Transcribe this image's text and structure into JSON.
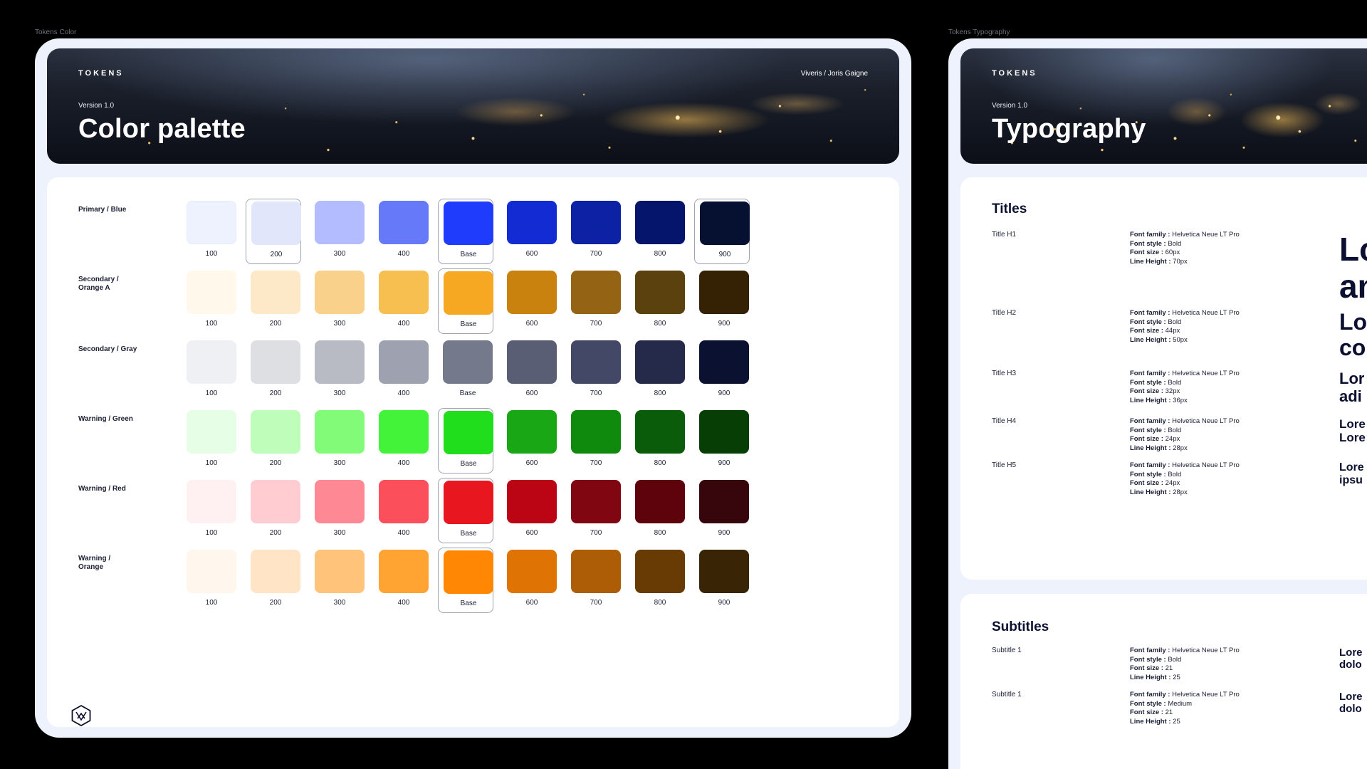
{
  "color_frame": {
    "label": "Tokens Color",
    "hero": {
      "tag": "TOKENS",
      "author": "Viveris / Joris Gaigne",
      "version": "Version 1.0",
      "title": "Color palette"
    },
    "palettes": [
      {
        "name": "Primary / Blue",
        "swatches": [
          {
            "label": "100",
            "color": "#eef2ff"
          },
          {
            "label": "200",
            "color": "#e1e6fb"
          },
          {
            "label": "300",
            "color": "#b2bcfe"
          },
          {
            "label": "400",
            "color": "#6679f9"
          },
          {
            "label": "Base",
            "color": "#1f3bfb"
          },
          {
            "label": "600",
            "color": "#122bd2"
          },
          {
            "label": "700",
            "color": "#0c21a3"
          },
          {
            "label": "800",
            "color": "#04156b"
          },
          {
            "label": "900",
            "color": "#061030"
          }
        ]
      },
      {
        "name": "Secondary / Orange A",
        "swatches": [
          {
            "label": "100",
            "color": "#fff8eb"
          },
          {
            "label": "200",
            "color": "#fde8c8"
          },
          {
            "label": "300",
            "color": "#f9d18a"
          },
          {
            "label": "400",
            "color": "#f7be50"
          },
          {
            "label": "Base",
            "color": "#f6a823"
          },
          {
            "label": "600",
            "color": "#c9820e"
          },
          {
            "label": "700",
            "color": "#956314"
          },
          {
            "label": "800",
            "color": "#5b410d"
          },
          {
            "label": "900",
            "color": "#352204"
          }
        ]
      },
      {
        "name": "Secondary / Gray",
        "swatches": [
          {
            "label": "100",
            "color": "#eff0f3"
          },
          {
            "label": "200",
            "color": "#dedfe3"
          },
          {
            "label": "300",
            "color": "#b9bbc4"
          },
          {
            "label": "400",
            "color": "#9ea1b0"
          },
          {
            "label": "Base",
            "color": "#75798c"
          },
          {
            "label": "600",
            "color": "#5a5e75"
          },
          {
            "label": "700",
            "color": "#444867"
          },
          {
            "label": "800",
            "color": "#252a4a"
          },
          {
            "label": "900",
            "color": "#0b1130"
          }
        ]
      },
      {
        "name": "Warning / Green",
        "swatches": [
          {
            "label": "100",
            "color": "#e6fde6"
          },
          {
            "label": "200",
            "color": "#bffdbb"
          },
          {
            "label": "300",
            "color": "#82fb79"
          },
          {
            "label": "400",
            "color": "#42f33a"
          },
          {
            "label": "Base",
            "color": "#21de1c"
          },
          {
            "label": "600",
            "color": "#19a715"
          },
          {
            "label": "700",
            "color": "#0f8a0c"
          },
          {
            "label": "800",
            "color": "#0b5c0a"
          },
          {
            "label": "900",
            "color": "#073e05"
          }
        ]
      },
      {
        "name": "Warning / Red",
        "swatches": [
          {
            "label": "100",
            "color": "#fff0f1"
          },
          {
            "label": "200",
            "color": "#ffccd1"
          },
          {
            "label": "300",
            "color": "#fe8995"
          },
          {
            "label": "400",
            "color": "#fb505c"
          },
          {
            "label": "Base",
            "color": "#e7161f"
          },
          {
            "label": "600",
            "color": "#bb0515"
          },
          {
            "label": "700",
            "color": "#800612"
          },
          {
            "label": "800",
            "color": "#5e030b"
          },
          {
            "label": "900",
            "color": "#36060c"
          }
        ]
      },
      {
        "name": "Warning / Orange",
        "swatches": [
          {
            "label": "100",
            "color": "#fff6ee"
          },
          {
            "label": "200",
            "color": "#ffe4c5"
          },
          {
            "label": "300",
            "color": "#ffc479"
          },
          {
            "label": "400",
            "color": "#ffa333"
          },
          {
            "label": "Base",
            "color": "#ff8703"
          },
          {
            "label": "600",
            "color": "#df7303"
          },
          {
            "label": "700",
            "color": "#ad5d05"
          },
          {
            "label": "800",
            "color": "#683a04"
          },
          {
            "label": "900",
            "color": "#392505"
          }
        ]
      }
    ],
    "selected": [
      [
        1,
        4,
        8
      ],
      [
        4
      ],
      [],
      [
        4
      ],
      [
        4
      ],
      [
        4
      ]
    ],
    "logo_icon": "hexagon-logo-icon"
  },
  "typography_frame": {
    "label": "Tokens Typography",
    "hero": {
      "tag": "TOKENS",
      "version": "Version 1.0",
      "title": "Typography"
    },
    "titles": {
      "heading": "Titles",
      "rows": [
        {
          "name": "Title H1",
          "family": "Helvetica Neue LT Pro",
          "style": "Bold",
          "size": "60px",
          "line_height": "70px",
          "sample": "Lo\nan",
          "sample_size": 46
        },
        {
          "name": "Title H2",
          "family": "Helvetica Neue LT Pro",
          "style": "Bold",
          "size": "44px",
          "line_height": "50px",
          "sample": "Lo\nco",
          "sample_size": 32
        },
        {
          "name": "Title H3",
          "family": "Helvetica Neue LT Pro",
          "style": "Bold",
          "size": "32px",
          "line_height": "36px",
          "sample": "Lor\nadi",
          "sample_size": 22
        },
        {
          "name": "Title H4",
          "family": "Helvetica Neue LT Pro",
          "style": "Bold",
          "size": "24px",
          "line_height": "28px",
          "sample": "Lore\nLore",
          "sample_size": 17
        },
        {
          "name": "Title H5",
          "family": "Helvetica Neue LT Pro",
          "style": "Bold",
          "size": "24px",
          "line_height": "28px",
          "sample": "Lore\nipsu",
          "sample_size": 16
        }
      ]
    },
    "subtitles": {
      "heading": "Subtitles",
      "rows": [
        {
          "name": "Subtitle 1",
          "family": "Helvetica Neue LT Pro",
          "style": "Bold",
          "size": "21",
          "line_height": "25",
          "sample": "Lore\ndolo",
          "sample_size": 15
        },
        {
          "name": "Subtitle 1",
          "family": "Helvetica Neue LT Pro",
          "style": "Medium",
          "size": "21",
          "line_height": "25",
          "sample": "Lore\ndolo",
          "sample_size": 15
        }
      ]
    },
    "prop_labels": {
      "family": "Font family :",
      "style": "Font style :",
      "size": "Font size :",
      "line_height": "Line Height :"
    }
  }
}
